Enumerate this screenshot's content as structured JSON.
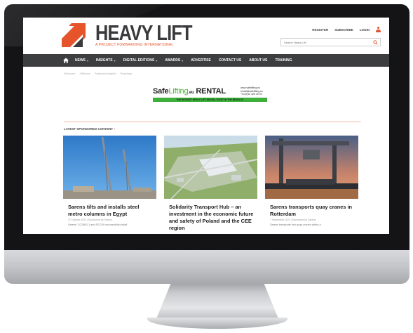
{
  "site": {
    "logo_text": "HEAVY LIFT",
    "logo_tagline": "A PROJECT FORWARDING INTERNATIONAL",
    "top_links": [
      "REGISTER",
      "SUBSCRIBE",
      "LOGIN"
    ],
    "search_placeholder": "Search Heavy Lift"
  },
  "nav": {
    "items": [
      {
        "label": "NEWS",
        "has_dropdown": true
      },
      {
        "label": "INSIGHTS",
        "has_dropdown": true
      },
      {
        "label": "DIGITAL EDITIONS",
        "has_dropdown": true
      },
      {
        "label": "AWARDS",
        "has_dropdown": true
      },
      {
        "label": "ADVERTISE",
        "has_dropdown": false
      },
      {
        "label": "CONTACT US",
        "has_dropdown": false
      },
      {
        "label": "ABOUT US",
        "has_dropdown": false
      },
      {
        "label": "TRAINING",
        "has_dropdown": false
      }
    ]
  },
  "breadcrumb": [
    "Welcome",
    "Offshore",
    "Featured insights",
    "Rankings"
  ],
  "ad": {
    "brand_prefix": "Safe",
    "brand_middle": "Lifting",
    "brand_domain": ".eu",
    "brand_suffix": " RENTAL",
    "contact_lines": [
      "www.safelifting.eu",
      "rental@safelifting.eu",
      "+31(0)10 428 40 00"
    ],
    "strip": "THE BIGGEST HEAVY LIFT RENTAL FLEET IN THE BENELUX"
  },
  "section": {
    "title": "LATEST SPONSORED CONTENT",
    "arrow": "›"
  },
  "cards": [
    {
      "title": "Sarens tilts and installs steel metro columns in Egypt",
      "meta": "27 October 2021 | Sponsored by Sarens",
      "excerpt": "Sarens' CC2800-1 and SGC90 successfully install"
    },
    {
      "title": "Solidarity Transport Hub – an investment in the economic future and safety of Poland and the CEE region",
      "meta": "",
      "excerpt": ""
    },
    {
      "title": "Sarens transports quay cranes in Rotterdam",
      "meta": "7 September 2021 | Sponsored by Sarens",
      "excerpt": "Sarens transports two quay cranes within a"
    }
  ],
  "colors": {
    "accent": "#e5542a",
    "nav_bg": "#3d3e40",
    "ad_green": "#3daf3a"
  }
}
